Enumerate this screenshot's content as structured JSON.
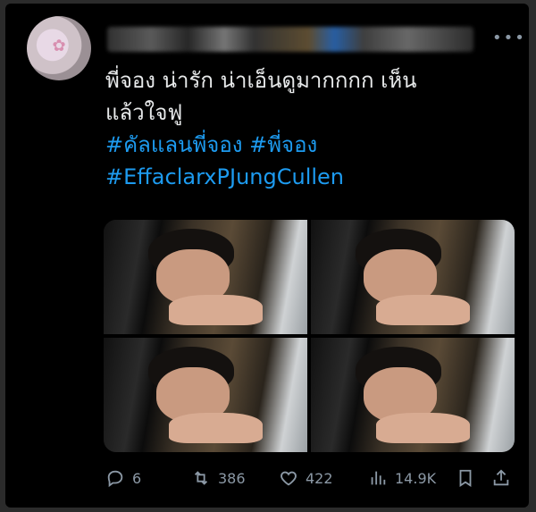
{
  "tweet": {
    "text_lines": [
      "พี่จอง น่ารัก น่าเอ็นดูมากกกก เห็น",
      "แล้วใจฟู"
    ],
    "hashtags_line1": "#คัลแลนพี่จอง #พี่จอง",
    "hashtags_line2": "#EffaclarxPJungCullen"
  },
  "actions": {
    "replies": "6",
    "retweets": "386",
    "likes": "422",
    "views": "14.9K"
  },
  "icons": {
    "more": "more-icon",
    "reply": "reply-icon",
    "retweet": "retweet-icon",
    "like": "heart-icon",
    "views": "views-icon",
    "bookmark": "bookmark-icon",
    "share": "share-icon"
  },
  "colors": {
    "background": "#000000",
    "text": "#e7e9ea",
    "hashtag": "#1d9bf0",
    "muted": "#8b98a5"
  }
}
